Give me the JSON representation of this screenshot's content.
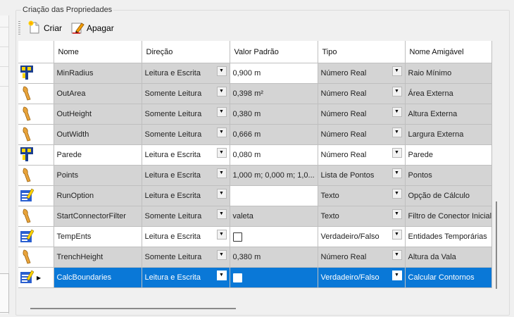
{
  "group": {
    "title": "Criação das Propriedades"
  },
  "toolbar": {
    "create_label": "Criar",
    "delete_label": "Apagar"
  },
  "columns": [
    "Nome",
    "Direção",
    "Valor Padrão",
    "Tipo",
    "Nome Amigável"
  ],
  "rows": [
    {
      "icon": "parameter-icon",
      "nome": "MinRadius",
      "direcao": "Leitura e Escrita",
      "valor": "0,900 m",
      "valor_type": "text",
      "tipo": "Número Real",
      "amigavel": "Raio Mínimo",
      "style": "gray",
      "valor_editable": true,
      "selected": false
    },
    {
      "icon": "output-icon",
      "nome": "OutArea",
      "direcao": "Somente Leitura",
      "valor": "0,398 m²",
      "valor_type": "text",
      "tipo": "Número Real",
      "amigavel": "Área Externa",
      "style": "gray",
      "valor_editable": false,
      "selected": false
    },
    {
      "icon": "output-icon",
      "nome": "OutHeight",
      "direcao": "Somente Leitura",
      "valor": "0,380 m",
      "valor_type": "text",
      "tipo": "Número Real",
      "amigavel": "Altura Externa",
      "style": "gray",
      "valor_editable": false,
      "selected": false
    },
    {
      "icon": "output-icon",
      "nome": "OutWidth",
      "direcao": "Somente Leitura",
      "valor": "0,666 m",
      "valor_type": "text",
      "tipo": "Número Real",
      "amigavel": "Largura Externa",
      "style": "gray",
      "valor_editable": false,
      "selected": false
    },
    {
      "icon": "parameter-icon",
      "nome": "Parede",
      "direcao": "Leitura e Escrita",
      "valor": "0,080 m",
      "valor_type": "text",
      "tipo": "Número Real",
      "amigavel": "Parede",
      "style": "white",
      "valor_editable": true,
      "selected": false
    },
    {
      "icon": "output-icon",
      "nome": "Points",
      "direcao": "Leitura e Escrita",
      "valor": "1,000 m; 0,000 m; 1,0...",
      "valor_type": "text",
      "tipo": "Lista de Pontos",
      "amigavel": "Pontos",
      "style": "gray",
      "valor_editable": false,
      "selected": false
    },
    {
      "icon": "edit-icon",
      "nome": "RunOption",
      "direcao": "Leitura e Escrita",
      "valor": "",
      "valor_type": "text",
      "tipo": "Texto",
      "amigavel": "Opção de Cálculo",
      "style": "gray",
      "valor_editable": true,
      "selected": false
    },
    {
      "icon": "output-icon",
      "nome": "StartConnectorFilter",
      "direcao": "Somente Leitura",
      "valor": "valeta",
      "valor_type": "text",
      "tipo": "Texto",
      "amigavel": "Filtro de Conector Inicial",
      "style": "gray",
      "valor_editable": false,
      "selected": false
    },
    {
      "icon": "edit-icon",
      "nome": "TempEnts",
      "direcao": "Leitura e Escrita",
      "valor": "",
      "valor_type": "checkbox",
      "tipo": "Verdadeiro/Falso",
      "amigavel": "Entidades Temporárias",
      "style": "white",
      "valor_editable": true,
      "selected": false
    },
    {
      "icon": "output-icon",
      "nome": "TrenchHeight",
      "direcao": "Somente Leitura",
      "valor": "0,380 m",
      "valor_type": "text",
      "tipo": "Número Real",
      "amigavel": "Altura da Vala",
      "style": "gray",
      "valor_editable": false,
      "selected": false
    },
    {
      "icon": "edit-icon",
      "nome": "CalcBoundaries",
      "direcao": "Leitura e Escrita",
      "valor": "",
      "valor_type": "checkbox",
      "tipo": "Verdadeiro/Falso",
      "amigavel": "Calcular Contornos",
      "style": "sel",
      "valor_editable": true,
      "selected": true
    }
  ],
  "colors": {
    "selection": "#0a78d7",
    "readonly_row": "#d4d4d4",
    "grid_line": "#bfbfbf"
  }
}
